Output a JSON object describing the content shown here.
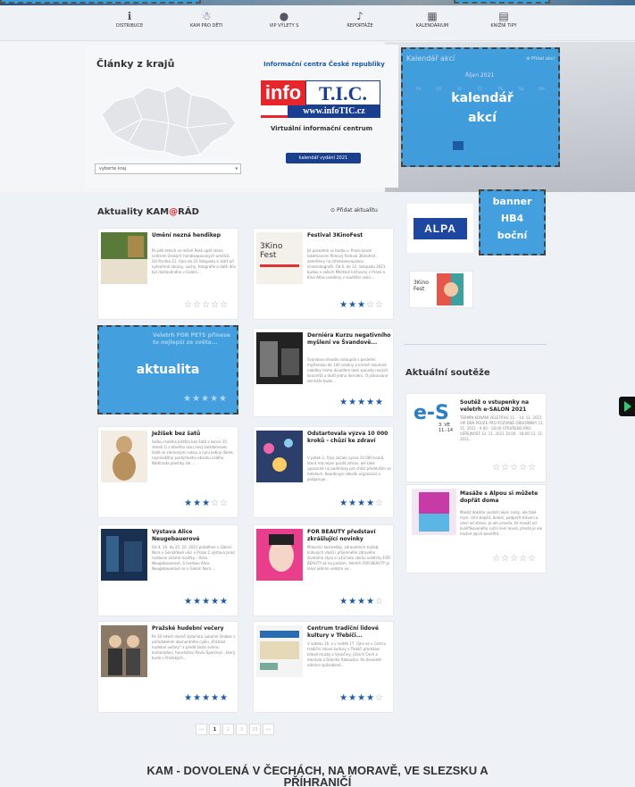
{
  "nav": [
    {
      "label": "DISTRIBUCE",
      "icon": "info-icon"
    },
    {
      "label": "KAM PRO DĚTI",
      "icon": "child-icon"
    },
    {
      "label": "VIP VÝLETY S",
      "icon": "person-icon"
    },
    {
      "label": "REPORTÁŽE",
      "icon": "microphone-icon"
    },
    {
      "label": "KALENDÁRIUM",
      "icon": "calendar-icon"
    },
    {
      "label": "KNIŽNÍ TIPY",
      "icon": "book-icon"
    }
  ],
  "regions": {
    "title": "Články z krajů",
    "select_placeholder": "vyberte kraj"
  },
  "infotic": {
    "title": "Informační centra České republiky",
    "logo_info": "info",
    "logo_tic": "T.I.C.",
    "logo_url": "www.infoTIC.cz",
    "subtitle": "Virtuální informační centrum",
    "button": "kalendář vydání 2021"
  },
  "calendar": {
    "heading": "Kalendář akcí",
    "add_link": "Přidat akci",
    "month": "Říjen 2021",
    "overlay_label": "kalendář akcí",
    "days": [
      "Po",
      "Út",
      "St",
      "Čt",
      "Pá",
      "So",
      "Ne"
    ]
  },
  "news": {
    "heading_pre": "Aktuality KAM",
    "heading_at": "@",
    "heading_post": "RÁD",
    "add_link": "Přidat aktualitu",
    "items": [
      {
        "title": "Umění nezná hendikep",
        "text": "Po pěti letech se míšeň Pokk opět stane centrem českých hendikepovaných umělců. Od čtvrtka 21. října do 23 listopadu si totiž při vytvořené obrazy, sochy, fotografie a další díla byl dostavěného v Galerii...",
        "stars": 0
      },
      {
        "title": "Festival 3KinoFest",
        "text": "Již posedmé se budou v Praze konat laketnaniení filmový festival 3Kinofest , zaměřený na střednoevropskou kinematografii. Od 6. do 12. listopadu 2021 budou v sálech Městské knihovny v Praze a Kina Atlas uvedeny v soutěžní sekci...",
        "stars": 3
      },
      {
        "title": "Veletrh FOR PETS přinese to nejlepší ze světa...",
        "text": "",
        "stars": 5,
        "overlay": "aktualita"
      },
      {
        "title": "Derniéra Kurzu negativního myšlení ve Švandově...",
        "text": "Švandovo divadlo vstoupilo s poslední myšlenkou do 14ti sezóny a kromě rozumné nabídky mimo divadlem také spousty nových koncertů a další jednu derniéru. O plánované derniéře bude...",
        "stars": 5
      },
      {
        "title": "Ježíšek bez šatů",
        "text": "Sošku malého Ježíška bez šatů z konce 15. století či z kterého rozu nový bezdomovec šedé se zlomenými rukou a nyní jediný dárek, nojmladšího pastýřského obsahu celého. Nádhrada plastiky zle...",
        "stars": 3
      },
      {
        "title": "Odstartovala výzva 10 000 kroků - chůzí ke zdraví",
        "text": "V pátek 1. října začala výzva 10 000 kroků, která má nejen posílit zdraví, ale také upozornit na podmínky pro chůzi především ve městech. Koordinuje několik organizací a podporuje...",
        "stars": 4
      },
      {
        "title": "Výstava Alice Neugebauerové",
        "text": "Od 4. 10. do 25. 10. 2021 proběhne v Galerii Nora v Goraždově ulici v Praze 2 výstava prací nedávno známé malířky – Alice Neugebauerové. S tvorbou Alice Neugebauerové se v Galerii Nora ...",
        "stars": 5
      },
      {
        "title": "FOR BEAUTY představí zkrášlující novinky",
        "text": "Milovníci kosmetiky, zdravotních služeb, krásných vlasů i příjemného zdravého životního stylu si užijí tuto sbírku veletrhu FOR BEAUTY až na podzim. Veletrh FOR BEAUTY je letos jedním velkým ve...",
        "stars": 4
      },
      {
        "title": "Pražské hudební večery",
        "text": "Po 30 letech skončí kytarista Lubomír Brabec s pořadatelem abonentního cyklu „Pražské hudební večery\" a předá žezlo svému kamarádovi, houslistovi Pavlu Šporclovi , který bude v Pražských...",
        "stars": 5
      },
      {
        "title": "Centrum tradiční lidové kultury v Třebíči...",
        "text": "V sobotu 16. a v neděli 17. října se v Centru tradiční lidové kultury v Třebíči představí lidové muzky z Vysočiny, jižních Čech a morávia a Dolního Rakouska. Po dvouleté odmlce způsobené...",
        "stars": 4
      }
    ]
  },
  "banner": {
    "alpa": "ALPA",
    "overlay": "banner HB4 boční"
  },
  "contests": {
    "heading": "Aktuální soutěže",
    "items": [
      {
        "title": "Soutěž o vstupenky na veletrh e-SALON 2021",
        "text": "TERMÍN KONÁNÍ VELETRHU 11. - 14. 11. 2021 VIP DEN POUZE PRO POZVANÉ OBDORNÍKY 11. 11. 2021 - 9:00 - 18:00 OTEVŘENO PRO VEŘEJNOST 12. 11. 2021 10:00 - 18:00 13. 11. 2021...",
        "stars": 0,
        "logo": "e-S",
        "logo_date": "3. VE",
        "logo_date2": "11.-14"
      },
      {
        "title": "Masáže s Alpou si můžete dopřát doma",
        "text": "Masáž dokáže uvolnit nejen svaly, ale také mysl. Umí zlepšit, bolest, podpořit trávení a uleví od stresu. Je ale pravda, že masáž od kvalifikovaného ruční není levná, přesto je ale možné jejich benefitů...",
        "stars": 0
      }
    ]
  },
  "pager": [
    "««",
    "1",
    "2",
    "3",
    "23",
    "»»"
  ],
  "footer": "KAM - DOVOLENÁ V ČECHÁCH, NA MORAVĚ, VE SLEZSKU A PŘÍHRANIČÍ"
}
